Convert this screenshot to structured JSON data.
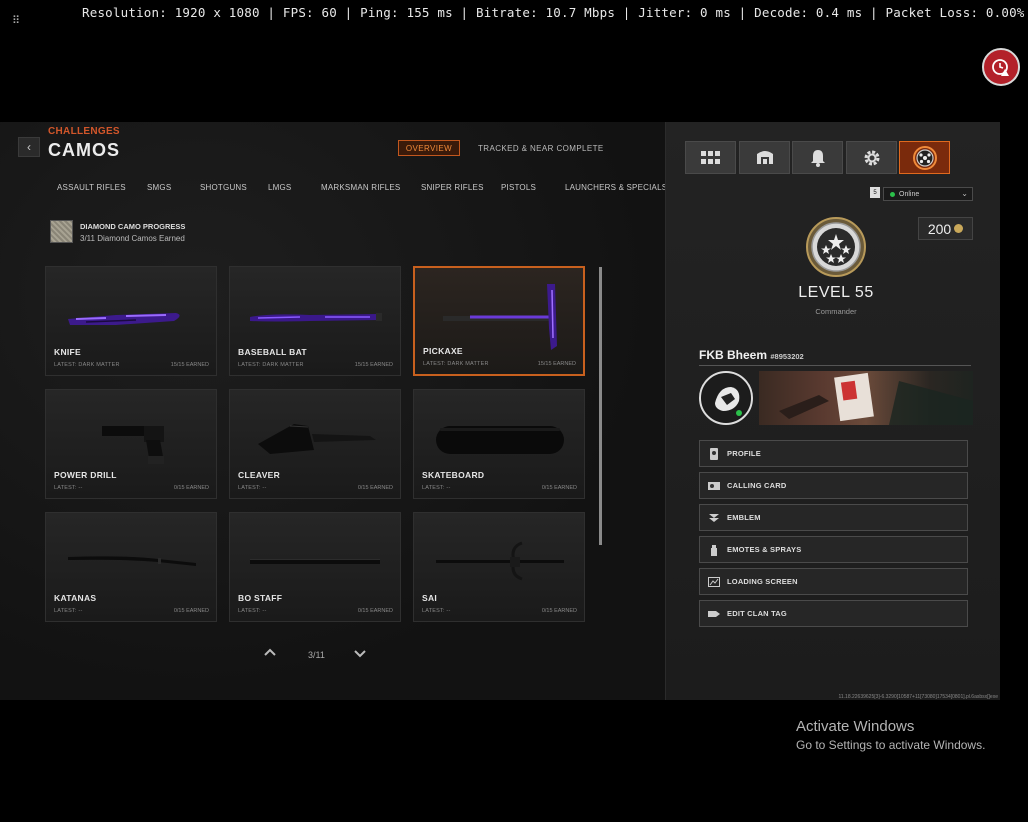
{
  "overlay": {
    "stats": "Resolution: 1920 x 1080 | FPS: 60 | Ping: 155 ms | Bitrate: 10.7 Mbps | Jitter: 0 ms | Decode: 0.4 ms | Packet Loss: 0.00%"
  },
  "header": {
    "breadcrumb": "CHALLENGES",
    "title": "CAMOS",
    "back_glyph": "‹",
    "tabs": [
      "OVERVIEW",
      "TRACKED & NEAR COMPLETE"
    ]
  },
  "categories": [
    "ASSAULT RIFLES",
    "SMGS",
    "SHOTGUNS",
    "LMGS",
    "MARKSMAN RIFLES",
    "SNIPER RIFLES",
    "PISTOLS",
    "LAUNCHERS & SPECIALS"
  ],
  "progress": {
    "title": "DIAMOND CAMO PROGRESS",
    "subtitle": "3/11 Diamond Camos Earned"
  },
  "weapons": [
    {
      "name": "KNIFE",
      "latest": "LATEST: DARK MATTER",
      "earned": "15/15 EARNED"
    },
    {
      "name": "BASEBALL BAT",
      "latest": "LATEST: DARK MATTER",
      "earned": "15/15 EARNED"
    },
    {
      "name": "PICKAXE",
      "latest": "LATEST: DARK MATTER",
      "earned": "15/15 EARNED"
    },
    {
      "name": "POWER DRILL",
      "latest": "LATEST: --",
      "earned": "0/15 EARNED"
    },
    {
      "name": "CLEAVER",
      "latest": "LATEST: --",
      "earned": "0/15 EARNED"
    },
    {
      "name": "SKATEBOARD",
      "latest": "LATEST: --",
      "earned": "0/15 EARNED"
    },
    {
      "name": "KATANAS",
      "latest": "LATEST: --",
      "earned": "0/15 EARNED"
    },
    {
      "name": "BO STAFF",
      "latest": "LATEST: --",
      "earned": "0/15 EARNED"
    },
    {
      "name": "SAI",
      "latest": "LATEST: --",
      "earned": "0/15 EARNED"
    }
  ],
  "pager": {
    "label": "3/11"
  },
  "profile": {
    "status_badge": "5",
    "status": "Online",
    "cod_points": "200",
    "level": "LEVEL 55",
    "rank_name": "Commander",
    "player_name": "FKB Bheem",
    "player_tag": "#8953202",
    "menu": [
      "PROFILE",
      "CALLING CARD",
      "EMBLEM",
      "EMOTES & SPRAYS",
      "LOADING SCREEN",
      "EDIT CLAN TAG"
    ],
    "build": "11.18.22639625[3]-6.3290[10587+11[73080]17534[0801].pl.6asbsx[]exe"
  },
  "windows": {
    "activate_title": "Activate Windows",
    "activate_sub": "Go to Settings to activate Windows."
  },
  "colors": {
    "accent": "#c8601e",
    "dark_matter": "#6a2ad8",
    "online": "#2bc04a"
  }
}
